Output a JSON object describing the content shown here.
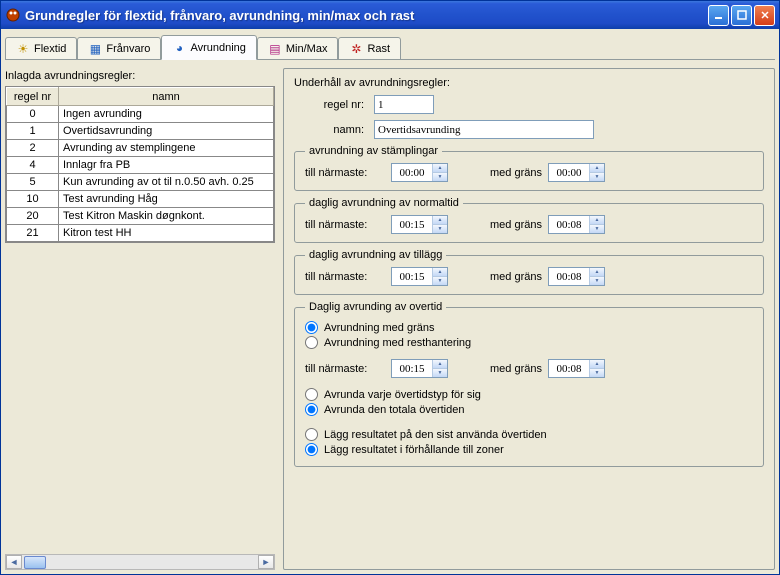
{
  "window": {
    "title": "Grundregler för flextid, frånvaro, avrundning, min/max och rast"
  },
  "tabs": [
    {
      "label": "Flextid",
      "icon": "⚙"
    },
    {
      "label": "Frånvaro",
      "icon": "⊞"
    },
    {
      "label": "Avrundning",
      "icon": "◷",
      "active": true
    },
    {
      "label": "Min/Max",
      "icon": "▥"
    },
    {
      "label": "Rast",
      "icon": "★"
    }
  ],
  "left": {
    "heading": "Inlagda avrundningsregler:",
    "col_regel": "regel nr",
    "col_namn": "namn",
    "rows": [
      {
        "nr": "0",
        "namn": "Ingen avrunding"
      },
      {
        "nr": "1",
        "namn": "Overtidsavrunding"
      },
      {
        "nr": "2",
        "namn": "Avrunding av stemplingene"
      },
      {
        "nr": "4",
        "namn": "Innlagr fra PB"
      },
      {
        "nr": "5",
        "namn": "Kun avrunding av ot til n.0.50 avh. 0.25"
      },
      {
        "nr": "10",
        "namn": "Test avrunding Håg"
      },
      {
        "nr": "20",
        "namn": "Test Kitron Maskin døgnkont."
      },
      {
        "nr": "21",
        "namn": "Kitron test HH"
      }
    ]
  },
  "right": {
    "heading": "Underhåll av avrundningsregler:",
    "regel_nr_label": "regel nr:",
    "regel_nr": "1",
    "namn_label": "namn:",
    "namn": "Overtidsavrunding",
    "grp_stampling": "avrundning av stämplingar",
    "grp_normaltid": "daglig avrundning av normaltid",
    "grp_tillagg": "daglig avrundning av tillägg",
    "grp_overtid": "Daglig avrunding av overtid",
    "till_narmaste": "till närmaste:",
    "med_grans": "med gräns",
    "stampling_nearest": "00:00",
    "stampling_limit": "00:00",
    "normaltid_nearest": "00:15",
    "normaltid_limit": "00:08",
    "tillagg_nearest": "00:15",
    "tillagg_limit": "00:08",
    "overtid_nearest": "00:15",
    "overtid_limit": "00:08",
    "radio_med_grans": "Avrundning med gräns",
    "radio_resthantering": "Avrundning med resthantering",
    "radio_varje_typ": "Avrunda varje övertidstyp för sig",
    "radio_totala": "Avrunda den totala övertiden",
    "radio_sist_anvanda": "Lägg resultatet på den sist använda övertiden",
    "radio_forhallande_zoner": "Lägg resultatet i förhållande till zoner"
  }
}
